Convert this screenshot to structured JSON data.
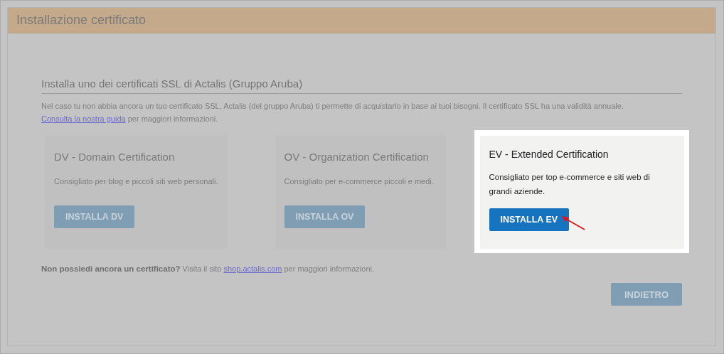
{
  "header": {
    "title": "Installazione certificato"
  },
  "section": {
    "title": "Installa uno dei certificati SSL di Actalis (Gruppo Aruba)",
    "intro": {
      "text": "Nel caso tu non abbia ancora un tuo certificato SSL, Actalis (del gruppo Aruba) ti permette di acquistarlo in base ai tuoi bisogni. Il certificato SSL ha una validità annuale.",
      "link": "Consulta la nostra guida",
      "after": " per maggiori informazioni."
    }
  },
  "cards": [
    {
      "title": "DV - Domain Certification",
      "description": "Consigliato per blog e piccoli siti web personali.",
      "button": "INSTALLA DV",
      "highlighted": false
    },
    {
      "title": "OV - Organization Certification",
      "description": "Consigliato per e-commerce piccoli e medi.",
      "button": "INSTALLA OV",
      "highlighted": false
    },
    {
      "title": "EV - Extended Certification",
      "description": "Consigliato per top e-commerce e siti web di grandi aziende.",
      "button": "INSTALLA EV",
      "highlighted": true
    }
  ],
  "footer_note": {
    "text": "**Non possiedi ancora un certificato?** Visita il sito ",
    "link": "shop.actalis.com",
    "after": " per maggiori informazioni."
  },
  "back_button": "INDIETRO"
}
